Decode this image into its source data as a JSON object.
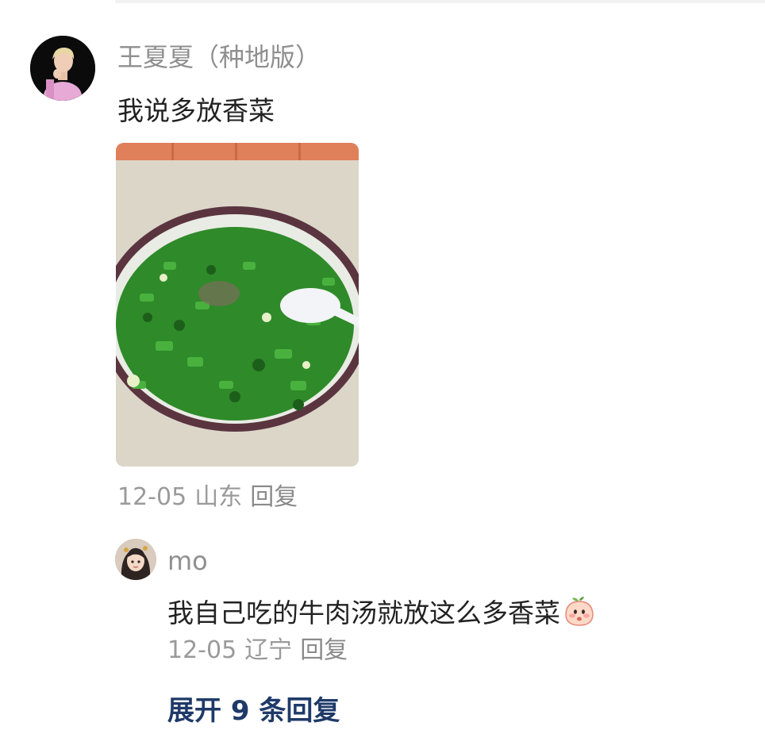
{
  "comment": {
    "username": "王夏夏（种地版）",
    "text": "我说多放香菜",
    "date": "12-05",
    "location": "山东",
    "reply_label": "回复"
  },
  "reply": {
    "username": "mo",
    "text": "我自己吃的牛肉汤就放这么多香菜",
    "emoji": "peach-face-icon",
    "date": "12-05",
    "location": "辽宁",
    "reply_label": "回复"
  },
  "expand_label": "展开 9 条回复",
  "colors": {
    "username": "#8f8f8f",
    "text": "#222222",
    "meta": "#9a9a9a",
    "expand_link": "#1f3a68"
  }
}
